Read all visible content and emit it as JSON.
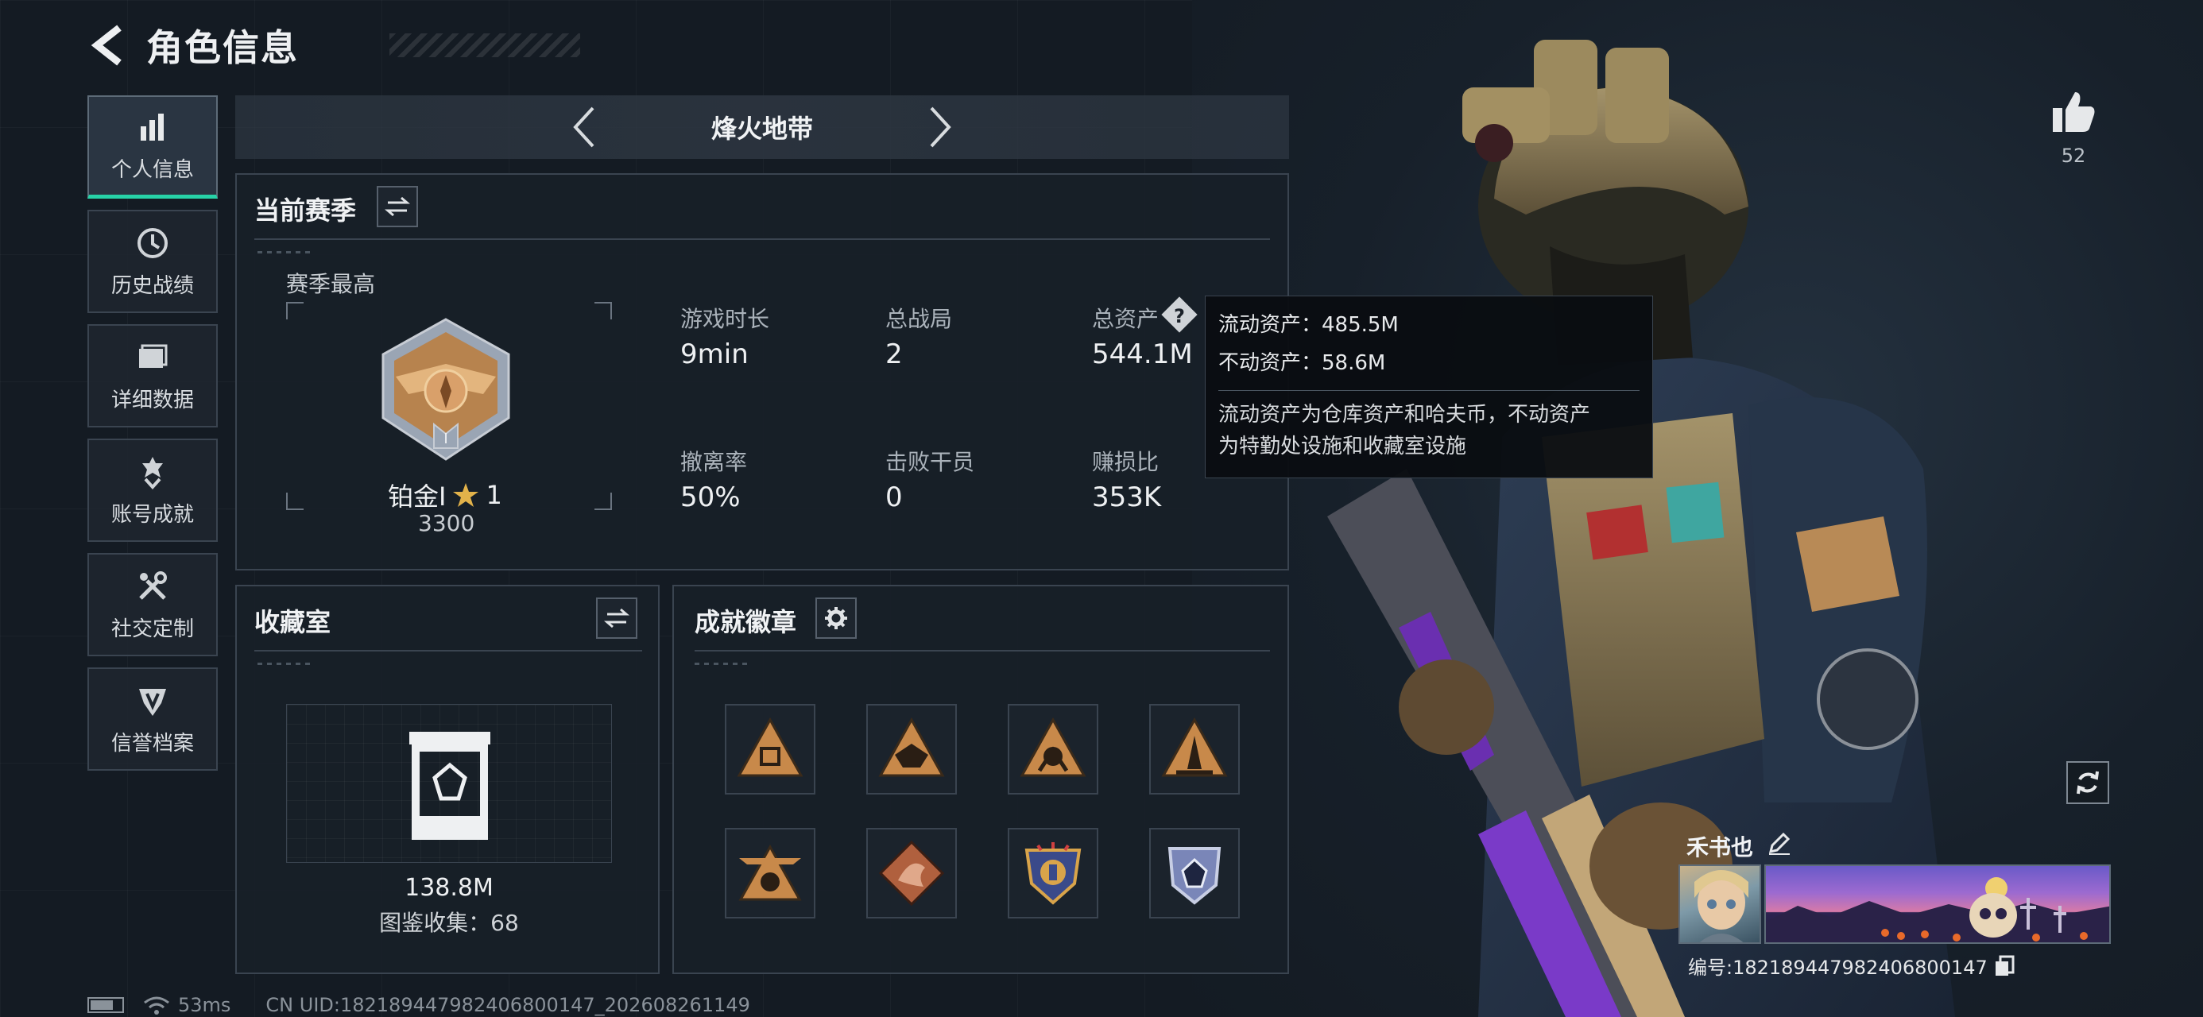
{
  "header": {
    "title": "角色信息"
  },
  "sidebar": {
    "items": [
      {
        "label": "个人信息",
        "icon": "bar-chart-icon",
        "active": true
      },
      {
        "label": "历史战绩",
        "icon": "clock-icon"
      },
      {
        "label": "详细数据",
        "icon": "folder-icon"
      },
      {
        "label": "账号成就",
        "icon": "achievement-icon"
      },
      {
        "label": "社交定制",
        "icon": "tools-icon"
      },
      {
        "label": "信誉档案",
        "icon": "shield-icon"
      }
    ]
  },
  "mode": {
    "label": "烽火地带"
  },
  "season": {
    "title": "当前赛季",
    "best_label": "赛季最高",
    "rank_name": "铂金Ⅰ",
    "rank_stars": "1",
    "rank_score": "3300",
    "stats": [
      {
        "label": "游戏时长",
        "value": "9min"
      },
      {
        "label": "总战局",
        "value": "2"
      },
      {
        "label": "总资产",
        "value": "544.1M"
      },
      {
        "label": "撤离率",
        "value": "50%"
      },
      {
        "label": "击败干员",
        "value": "0"
      },
      {
        "label": "赚损比",
        "value": "353K"
      }
    ]
  },
  "tooltip": {
    "liquid": "流动资产：485.5M",
    "fixed": "不动资产：58.6M",
    "note_line1": "流动资产为仓库资产和哈夫币，不动资产",
    "note_line2": "为特勤处设施和收藏室设施"
  },
  "collection": {
    "title": "收藏室",
    "value": "138.8M",
    "catalog": "图鉴收集：68"
  },
  "badges": {
    "title": "成就徽章",
    "items": [
      {
        "name": "badge-1",
        "color": "#c8894a"
      },
      {
        "name": "badge-2",
        "color": "#c8894a"
      },
      {
        "name": "badge-3",
        "color": "#c8894a"
      },
      {
        "name": "badge-4",
        "color": "#c8894a"
      },
      {
        "name": "badge-5",
        "color": "#c8894a"
      },
      {
        "name": "badge-6",
        "color": "#b0603e"
      },
      {
        "name": "badge-7",
        "color": "#3a4a8a"
      },
      {
        "name": "badge-8",
        "color": "#7a86b8"
      }
    ]
  },
  "profile": {
    "likes": "52",
    "name": "禾书也",
    "uid_label": "编号:182189447982406800147"
  },
  "status": {
    "ping": "53ms",
    "server_uid": "CN UID:182189447982406800147_202608261149"
  },
  "colors": {
    "accent": "#27d3a8",
    "panel_border": "#3a4450",
    "badge_gold": "#c8894a"
  }
}
